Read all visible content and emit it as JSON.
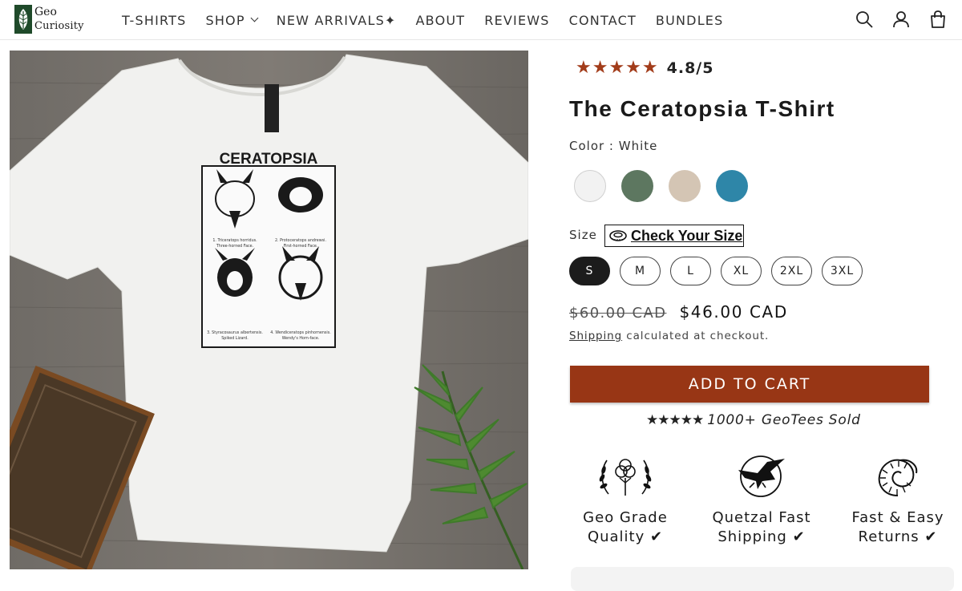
{
  "brand": {
    "line1": "Geo",
    "line2": "Curiosity"
  },
  "nav": {
    "items": [
      {
        "label": "T-SHIRTS"
      },
      {
        "label": "SHOP"
      },
      {
        "label": "NEW ARRIVALS✦"
      },
      {
        "label": "ABOUT"
      },
      {
        "label": "REVIEWS"
      },
      {
        "label": "CONTACT"
      },
      {
        "label": "BUNDLES"
      }
    ]
  },
  "header_icons": [
    "search-icon",
    "account-icon",
    "cart-icon"
  ],
  "product_image": {
    "shirt_print_title": "CERATOPSIA",
    "captions": [
      {
        "name": "1. Triceratops horridus.",
        "common": "Three-horned Face."
      },
      {
        "name": "2. Protoceratops andrewsi.",
        "common": "First-horned Face."
      },
      {
        "name": "3. Styracosaurus albertensis.",
        "common": "Spiked Lizard."
      },
      {
        "name": "4. Wendiceratops pinhornensis.",
        "common": "Wendy's Horn-face."
      }
    ]
  },
  "product": {
    "rating_stars": "★★★★★",
    "rating": "4.8/5",
    "title": "The Ceratopsia T-Shirt",
    "color_label": "Color : White",
    "colors": [
      "#f2f2f2",
      "#5d7760",
      "#d4c5b4",
      "#2e86a8"
    ],
    "size_label": "Size",
    "size_guide_label": "Check Your Size",
    "sizes": [
      "S",
      "M",
      "L",
      "XL",
      "2XL",
      "3XL"
    ],
    "selected_size": "S",
    "price_old": "$60.00 CAD",
    "price_new": "$46.00 CAD",
    "shipping_link": "Shipping",
    "shipping_text": "calculated at checkout.",
    "add_to_cart": "ADD TO CART",
    "sold_stars": "★★★★★",
    "sold_text": "1000+ GeoTees Sold",
    "accent_color": "#983615"
  },
  "features": [
    {
      "line1": "Geo Grade",
      "line2": "Quality ✔",
      "icon": "cotton-wreath-icon"
    },
    {
      "line1": "Quetzal Fast",
      "line2": "Shipping ✔",
      "icon": "pterosaur-icon"
    },
    {
      "line1": "Fast & Easy",
      "line2": "Returns ✔",
      "icon": "ammonite-icon"
    }
  ]
}
